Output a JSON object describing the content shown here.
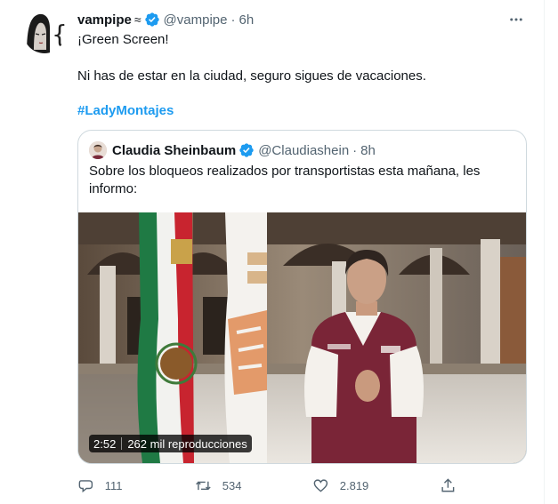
{
  "tweet": {
    "display_name": "vampipe",
    "name_glyph": "≈",
    "handle": "@vampipe",
    "separator": "·",
    "time": "6h",
    "line1": "¡Green Screen!",
    "line2": "Ni has de estar en la ciudad, seguro sigues de vacaciones.",
    "hashtag": "#LadyMontajes"
  },
  "quote": {
    "display_name": "Claudia Sheinbaum",
    "handle": "@Claudiashein",
    "separator": "·",
    "time": "8h",
    "text": "Sobre los bloqueos realizados por transportistas esta mañana, les informo:"
  },
  "video": {
    "duration": "2:52",
    "views": "262 mil reproducciones"
  },
  "actions": {
    "replies": "111",
    "retweets": "534",
    "likes": "2.819"
  },
  "colors": {
    "accent": "#1d9bf0",
    "secondary_text": "#536471",
    "border": "#cfd9de"
  }
}
